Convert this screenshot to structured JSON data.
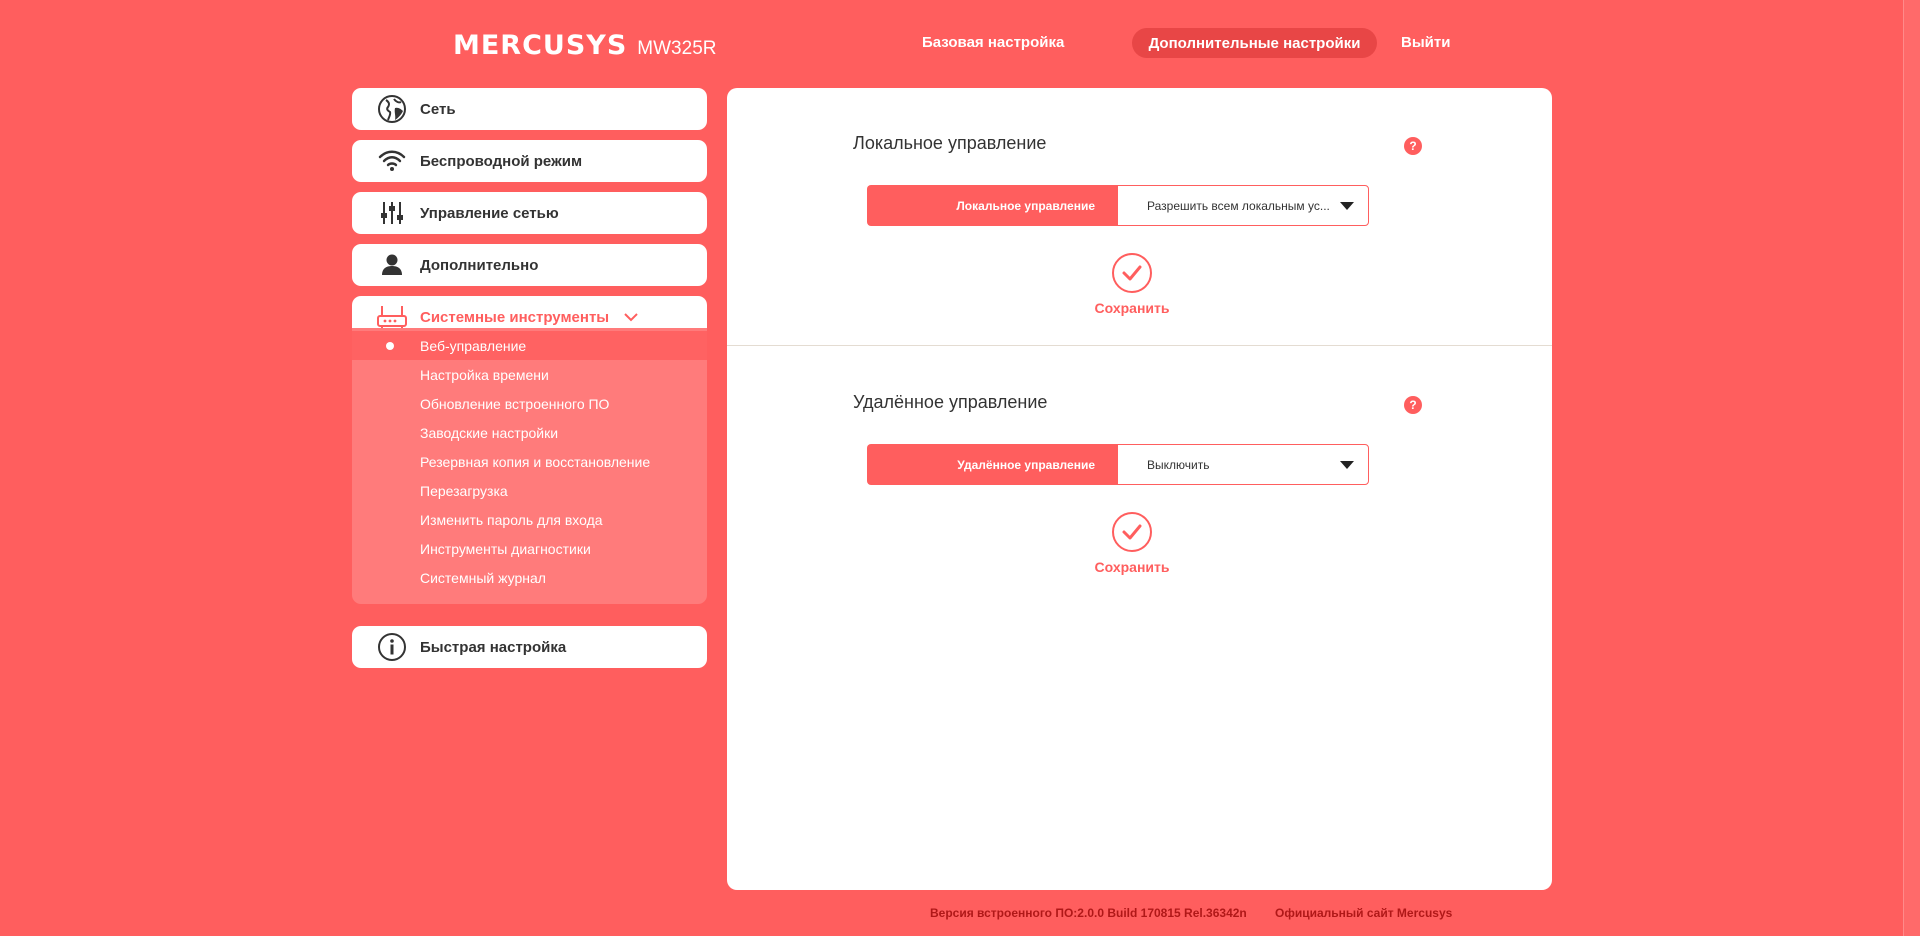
{
  "header": {
    "brand": "MERCUSYS",
    "model": "MW325R",
    "nav": {
      "basic": "Базовая настройка",
      "advanced": "Дополнительные настройки",
      "logout": "Выйти"
    }
  },
  "sidebar": {
    "items": [
      {
        "label": "Сеть",
        "icon": "globe-icon"
      },
      {
        "label": "Беспроводной режим",
        "icon": "wifi-icon"
      },
      {
        "label": "Управление сетью",
        "icon": "sliders-icon"
      },
      {
        "label": "Дополнительно",
        "icon": "user-icon"
      },
      {
        "label": "Системные инструменты",
        "icon": "router-icon",
        "expanded": true
      },
      {
        "label": "Быстрая настройка",
        "icon": "info-icon"
      }
    ],
    "submenu": [
      {
        "label": "Веб-управление",
        "active": true
      },
      {
        "label": "Настройка времени"
      },
      {
        "label": "Обновление встроенного ПО"
      },
      {
        "label": "Заводские настройки"
      },
      {
        "label": "Резервная копия и восстановление"
      },
      {
        "label": "Перезагрузка"
      },
      {
        "label": "Изменить пароль для входа"
      },
      {
        "label": "Инструменты диагностики"
      },
      {
        "label": "Системный журнал"
      }
    ]
  },
  "main": {
    "local": {
      "title": "Локальное управление",
      "field_label": "Локальное управление",
      "field_value": "Разрешить всем локальным ус...",
      "save_label": "Сохранить"
    },
    "remote": {
      "title": "Удалённое управление",
      "field_label": "Удалённое управление",
      "field_value": "Выключить",
      "save_label": "Сохранить"
    },
    "help_glyph": "?"
  },
  "footer": {
    "firmware": "Версия встроенного ПО:2.0.0 Build 170815 Rel.36342n",
    "official_site": "Официальный сайт Mercusys"
  },
  "colors": {
    "background": "#ff5e5e",
    "accent": "#ff5e5e",
    "nav_active": "#e84646",
    "submenu_bg": "#ff7b7b",
    "footer_text": "#b01818"
  }
}
